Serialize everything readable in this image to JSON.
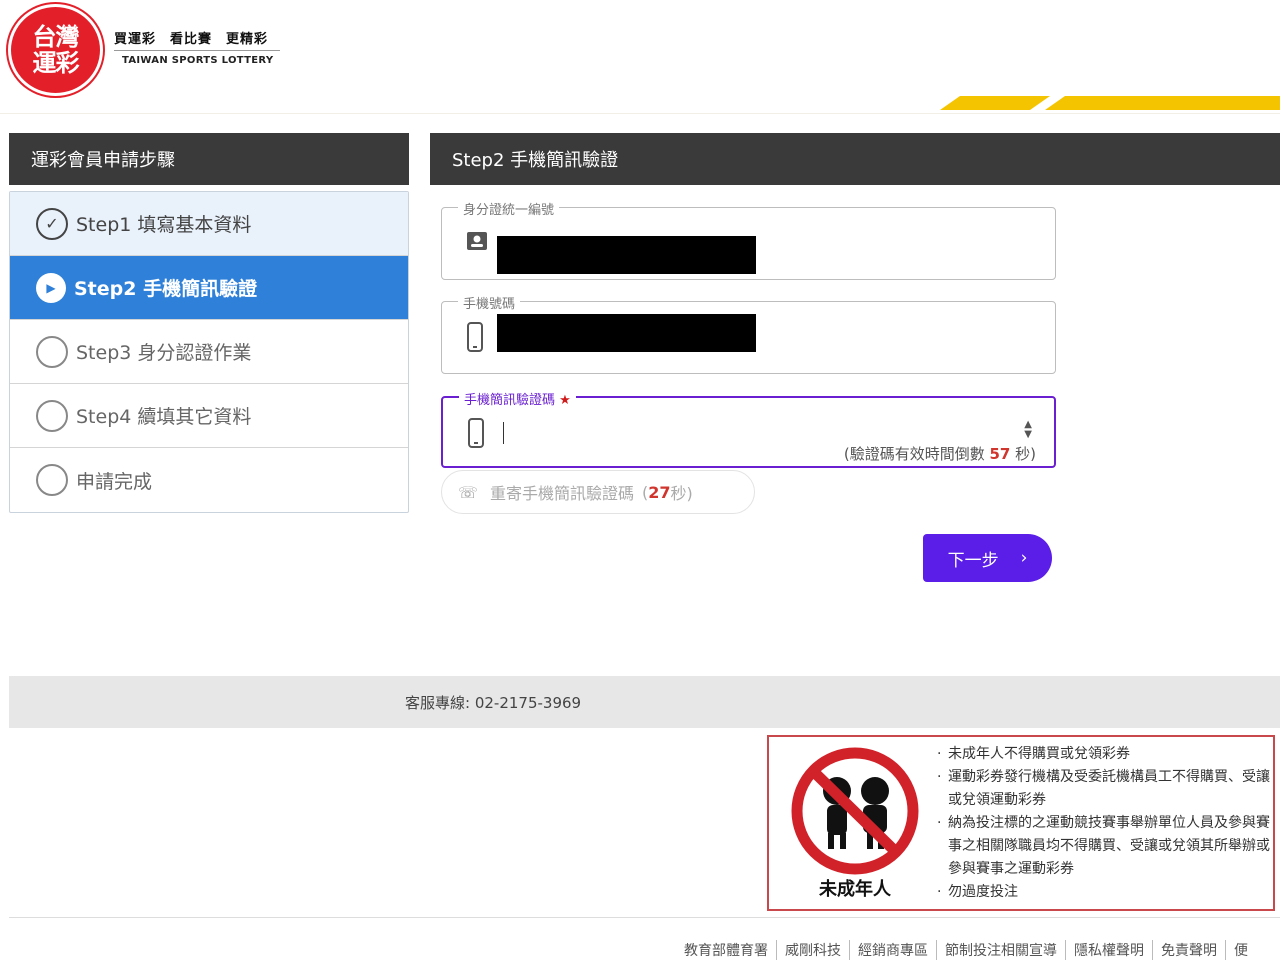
{
  "header": {
    "logo_text": "台灣運彩",
    "slogan": "買運彩　看比賽　更精彩",
    "brand_en": "TAIWAN SPORTS LOTTERY",
    "accent_color": "#f4c400"
  },
  "steps_panel": {
    "title": "運彩會員申請步驟",
    "items": [
      {
        "label": "Step1 填寫基本資料",
        "state": "done"
      },
      {
        "label": "Step2 手機簡訊驗證",
        "state": "active"
      },
      {
        "label": "Step3 身分認證作業",
        "state": "pending"
      },
      {
        "label": "Step4 續填其它資料",
        "state": "pending"
      },
      {
        "label": "申請完成",
        "state": "pending"
      }
    ]
  },
  "form": {
    "title": "Step2 手機簡訊驗證",
    "id_field": {
      "label": "身分證統一編號",
      "icon": "id-card-icon",
      "value_redacted": true
    },
    "phone_field": {
      "label": "手機號碼",
      "icon": "mobile-phone-icon",
      "value_redacted": true
    },
    "sms_field": {
      "label": "手機簡訊驗證碼",
      "required_mark": "★",
      "icon": "mobile-phone-icon",
      "value": "",
      "countdown_prefix": "(驗證碼有效時間倒數",
      "countdown_value": "57",
      "countdown_suffix": "秒)"
    },
    "resend": {
      "label": "重寄手機簡訊驗證碼",
      "open": "(",
      "seconds": "27",
      "suffix": "秒)",
      "icon": "phone-call-icon"
    },
    "next_button": {
      "label": "下一步",
      "icon": "chevron-right-icon",
      "color": "#5a1ee8"
    }
  },
  "footer": {
    "service_line": "客服專線: 02-2175-3969",
    "notice_image_caption": "未成年人",
    "notices": [
      "未成年人不得購買或兌領彩券",
      "運動彩券發行機構及受委託機構員工不得購買、受讓或兌領運動彩券",
      "納為投注標的之運動競技賽事舉辦單位人員及參與賽事之相關隊職員均不得購買、受讓或兌領其所舉辦或參與賽事之運動彩券",
      "勿過度投注"
    ],
    "links": [
      "教育部體育署",
      "威剛科技",
      "經銷商專區",
      "節制投注相關宣導",
      "隱私權聲明",
      "免責聲明",
      "便"
    ]
  }
}
